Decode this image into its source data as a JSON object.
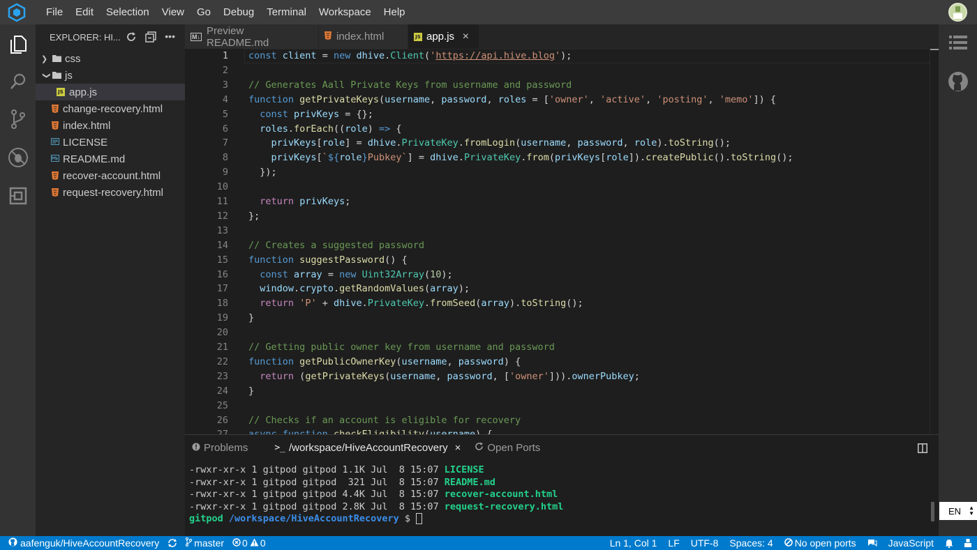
{
  "menu": [
    "File",
    "Edit",
    "Selection",
    "View",
    "Go",
    "Debug",
    "Terminal",
    "Workspace",
    "Help"
  ],
  "sidebar": {
    "header": "EXPLORER: HI...",
    "items": [
      {
        "label": "css",
        "kind": "folder",
        "expanded": false
      },
      {
        "label": "js",
        "kind": "folder",
        "expanded": true
      },
      {
        "label": "app.js",
        "kind": "js",
        "selected": true
      },
      {
        "label": "change-recovery.html",
        "kind": "html"
      },
      {
        "label": "index.html",
        "kind": "html"
      },
      {
        "label": "LICENSE",
        "kind": "license"
      },
      {
        "label": "README.md",
        "kind": "md"
      },
      {
        "label": "recover-account.html",
        "kind": "html"
      },
      {
        "label": "request-recovery.html",
        "kind": "html"
      }
    ]
  },
  "tabs": [
    {
      "label": "Preview README.md",
      "icon": "M↓"
    },
    {
      "label": "index.html",
      "icon": "html-icon"
    },
    {
      "label": "app.js",
      "icon": "JS",
      "active": true,
      "close": "×"
    }
  ],
  "editor": {
    "line_numbers": [
      "1",
      "2",
      "3",
      "4",
      "5",
      "6",
      "7",
      "8",
      "9",
      "10",
      "11",
      "12",
      "13",
      "14",
      "15",
      "16",
      "17",
      "18",
      "19",
      "20",
      "21",
      "22",
      "23",
      "24",
      "25",
      "26",
      "27"
    ]
  },
  "panel": {
    "tabs": [
      "Problems",
      "/workspace/HiveAccountRecovery",
      "Open Ports"
    ],
    "terminal_lines": [
      {
        "perm": "-rwxr-xr-x 1 gitpod gitpod 1.1K Jul  8 15:07 ",
        "file": "LICENSE"
      },
      {
        "perm": "-rwxr-xr-x 1 gitpod gitpod  321 Jul  8 15:07 ",
        "file": "README.md"
      },
      {
        "perm": "-rwxr-xr-x 1 gitpod gitpod 4.4K Jul  8 15:07 ",
        "file": "recover-account.html"
      },
      {
        "perm": "-rwxr-xr-x 1 gitpod gitpod 2.8K Jul  8 15:07 ",
        "file": "request-recovery.html"
      }
    ],
    "prompt_user": "gitpod",
    "prompt_path": "/workspace/HiveAccountRecovery",
    "prompt_symbol": "$"
  },
  "language_box": "EN",
  "status": {
    "repo": "aafenguk/HiveAccountRecovery",
    "branch": "master",
    "errors": "0",
    "warnings": "0",
    "position": "Ln 1, Col 1",
    "eol": "LF",
    "encoding": "UTF-8",
    "spaces": "Spaces: 4",
    "ports": "No open ports",
    "language": "JavaScript"
  },
  "colors": {
    "accent": "#007acc",
    "sidebar": "#252526",
    "editor": "#1e1e1e"
  }
}
